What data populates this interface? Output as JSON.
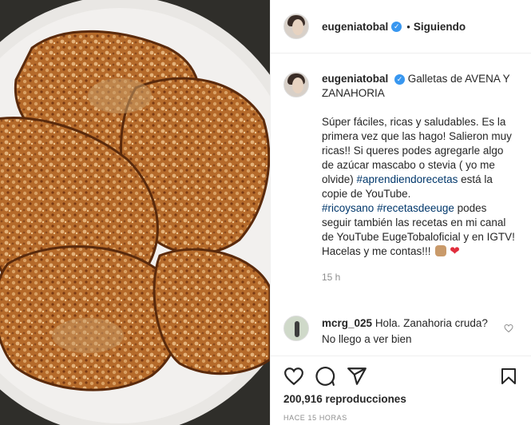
{
  "post": {
    "username": "eugeniatobal",
    "follow_status": "Siguiendo",
    "separator": "•"
  },
  "caption": {
    "username": "eugeniatobal",
    "title": "Galletas de AVENA Y ZANAHORIA",
    "p1": "Súper fáciles, ricas y saludables. Es la primera vez que las hago! Salieron muy ricas!! Si queres podes agregarle algo de azúcar mascabo o stevia ( yo me olvide) ",
    "tag1": "#aprendiendorecetas",
    "p1b": " está la copie de YouTube.",
    "tag2": "#ricoysano",
    "tag3": "#recetasdeeuge",
    "p2": " podes seguir también las recetas en mi canal de YouTube EugeTobaloficial y en IGTV!",
    "p3": "Hacelas y me contas!!!",
    "heart": "❤",
    "time": "15 h"
  },
  "comment": {
    "username": "mcrg_025",
    "text": "Hola. Zanahoria cruda? No llego a ver bien"
  },
  "stats": {
    "views": "200,916 reproducciones",
    "ago": "HACE 15 HORAS"
  },
  "colors": {
    "link": "#00376b",
    "verified": "#3897f0",
    "muted": "#8e8e8e"
  },
  "icons": [
    "like-icon",
    "comment-icon",
    "share-icon",
    "save-icon",
    "verified-badge-icon",
    "comment-like-icon"
  ]
}
